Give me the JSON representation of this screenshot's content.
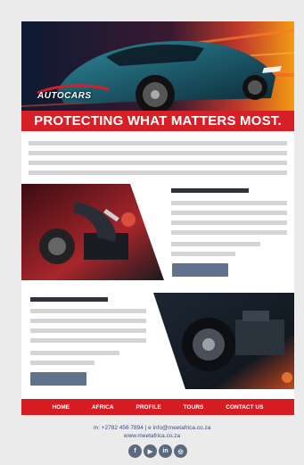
{
  "brand": {
    "logo_text": "AUTOCARS",
    "banner": "PROTECTING WHAT MATTERS MOST.",
    "accent": "#d61f26"
  },
  "nav": {
    "items": [
      "HOME",
      "AFRICA",
      "PROFILE",
      "TOURS",
      "CONTACT US"
    ]
  },
  "footer": {
    "contact_line": "m: +2782 456 7894  |  e info@meetafrica.co.za",
    "website": "www.meetafrica.co.za",
    "socials": [
      {
        "name": "facebook",
        "glyph": "f"
      },
      {
        "name": "youtube",
        "glyph": "▶"
      },
      {
        "name": "linkedin",
        "glyph": "in"
      },
      {
        "name": "instagram",
        "glyph": "◎"
      }
    ]
  }
}
